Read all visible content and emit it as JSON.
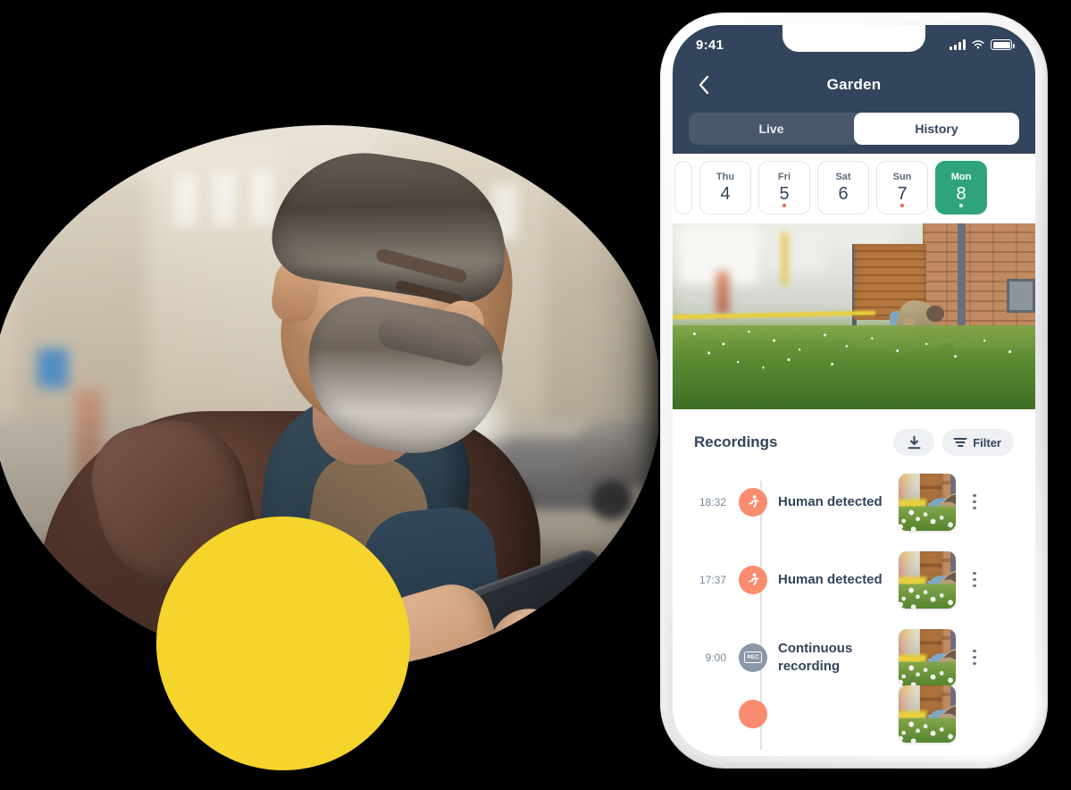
{
  "phone": {
    "status_bar": {
      "time": "9:41",
      "icons": [
        "signal-icon",
        "wifi-icon",
        "battery-icon"
      ]
    },
    "nav": {
      "back_icon": "chevron-left-icon",
      "title": "Garden"
    },
    "segmented_control": {
      "options": [
        {
          "label": "Live",
          "active": false
        },
        {
          "label": "History",
          "active": true
        }
      ]
    },
    "date_strip": [
      {
        "weekday": "",
        "day": "",
        "partial": true,
        "active": false,
        "dot": ""
      },
      {
        "weekday": "Thu",
        "day": "4",
        "partial": false,
        "active": false,
        "dot": ""
      },
      {
        "weekday": "Fri",
        "day": "5",
        "partial": false,
        "active": false,
        "dot": "#f4604a"
      },
      {
        "weekday": "Sat",
        "day": "6",
        "partial": false,
        "active": false,
        "dot": ""
      },
      {
        "weekday": "Sun",
        "day": "7",
        "partial": false,
        "active": false,
        "dot": "#f4604a"
      },
      {
        "weekday": "Mon",
        "day": "8",
        "partial": false,
        "active": true,
        "dot": "#ffffff"
      }
    ],
    "camera_feed": {
      "name": "camera-feed-image",
      "description": "Garden camera view with brick wall, wooden fence and flower meadow"
    },
    "recordings": {
      "title": "Recordings",
      "download_icon": "download-icon",
      "filter_icon": "filter-icon",
      "filter_label": "Filter",
      "items": [
        {
          "time": "18:32",
          "label": "Human detected",
          "icon": "running-person-icon",
          "icon_color": "#f98b6e",
          "menu_icon": "more-vertical-icon"
        },
        {
          "time": "17:37",
          "label": "Human detected",
          "icon": "running-person-icon",
          "icon_color": "#f98b6e",
          "menu_icon": "more-vertical-icon"
        },
        {
          "time": "9:00",
          "label": "Continuous recording",
          "icon": "rec-badge-icon",
          "icon_color": "#8b97a6",
          "menu_icon": "more-vertical-icon"
        }
      ]
    }
  },
  "hero": {
    "photo_name": "man-looking-at-phone-photo",
    "photo_alt": "Bearded man in leather jacket and scarf looking at his smartphone on a city street",
    "yellow_circle_color": "#f5d42b"
  },
  "theme": {
    "header_bg": "#33455c",
    "accent_green": "#2ea37e",
    "accent_orange": "#f98b6e",
    "accent_yellow": "#f5d42b",
    "page_bg": "#000000"
  }
}
